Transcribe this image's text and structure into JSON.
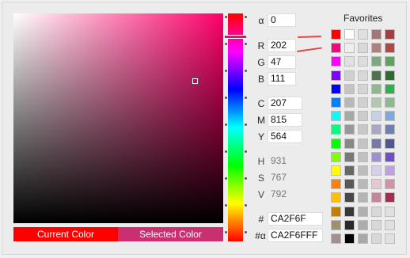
{
  "favorites_title": "Favorites",
  "current_color_label": "Current Color",
  "selected_color_label": "Selected Color",
  "current_color": "#ff0000",
  "selected_color": "#ca2f6f",
  "fields": {
    "alpha": {
      "label": "α",
      "value": "0"
    },
    "r": {
      "label": "R",
      "value": "202"
    },
    "g": {
      "label": "G",
      "value": "47"
    },
    "b": {
      "label": "B",
      "value": "111"
    },
    "c": {
      "label": "C",
      "value": "207"
    },
    "m": {
      "label": "M",
      "value": "815"
    },
    "y": {
      "label": "Y",
      "value": "564"
    },
    "h": {
      "label": "H",
      "value": "931"
    },
    "s": {
      "label": "S",
      "value": "767"
    },
    "v": {
      "label": "V",
      "value": "792"
    },
    "hex": {
      "label": "#",
      "value": "CA2F6F"
    },
    "hex_alpha": {
      "label": "#α",
      "value": "CA2F6FFF"
    }
  },
  "favorites": [
    [
      "#ff0000",
      "#ffffff",
      "#e0e0e0",
      "#a07878",
      "#a04040"
    ],
    [
      "#ff0080",
      "#eeeeee",
      "#d8d8d8",
      "#b08080",
      "#b04848"
    ],
    [
      "#ff00ff",
      "#e0e0e0",
      "#dddddd",
      "#80a880",
      "#60a060"
    ],
    [
      "#8000ff",
      "#d0d0d0",
      "#d8d8d8",
      "#507050",
      "#306a30"
    ],
    [
      "#0000ff",
      "#c4c4c4",
      "#d4d4d4",
      "#90b890",
      "#30b050"
    ],
    [
      "#0080ff",
      "#b8b8b8",
      "#d0d0d0",
      "#b0c8b0",
      "#90b890"
    ],
    [
      "#00ffff",
      "#a8a8a8",
      "#cccccc",
      "#c8d0e8",
      "#80a8e0"
    ],
    [
      "#00ff80",
      "#989898",
      "#c8c8c8",
      "#a8a8c0",
      "#7080b0"
    ],
    [
      "#00ff00",
      "#888888",
      "#c4c4c4",
      "#7878a0",
      "#505890"
    ],
    [
      "#80ff00",
      "#787878",
      "#c0c0c0",
      "#a090d0",
      "#7050c0"
    ],
    [
      "#ffff00",
      "#686868",
      "#bcbcbc",
      "#d8d0e8",
      "#c0a0e0"
    ],
    [
      "#ff8000",
      "#585858",
      "#b8b8b8",
      "#e8c8d0",
      "#d890a8"
    ],
    [
      "#ffc000",
      "#484848",
      "#b4b4b4",
      "#c08898",
      "#a03050"
    ],
    [
      "#c08000",
      "#383838",
      "#b0b0b0",
      "#d8d8d8",
      "#e0e0e0"
    ],
    [
      "#a09070",
      "#282828",
      "#acacac",
      "#d8d8d8",
      "#e0e0e0"
    ],
    [
      "#a09090",
      "#000000",
      "#a8a8a8",
      "#d8d8d8",
      "#e0e0e0"
    ]
  ]
}
